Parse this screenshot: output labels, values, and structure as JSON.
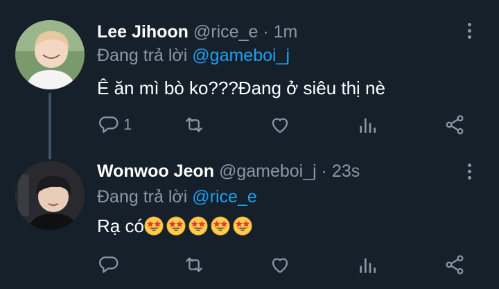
{
  "tweets": [
    {
      "name": "Lee Jihoon",
      "handle": "@rice_e",
      "dot": "·",
      "time": "1m",
      "reply_prefix": "Đang trả lời",
      "reply_to": "@gameboi_j",
      "text": "Ê ăn mì bò ko???Đang ở siêu thị nè",
      "reply_count": "1",
      "avatar_icon": "profile-photo-smiling-boy",
      "icons": [
        "more-vertical-icon",
        "reply-icon",
        "retweet-icon",
        "like-icon",
        "analytics-icon",
        "share-icon"
      ]
    },
    {
      "name": "Wonwoo Jeon",
      "handle": "@gameboi_j",
      "dot": "·",
      "time": "23s",
      "reply_prefix": "Đang trả lời",
      "reply_to": "@rice_e",
      "text": "Rạ có",
      "emoji": "star-struck-emoji ×5",
      "avatar_icon": "profile-photo-boy-dark-hair",
      "icons": [
        "more-vertical-icon",
        "reply-icon",
        "retweet-icon",
        "like-icon",
        "analytics-icon",
        "share-icon"
      ]
    }
  ],
  "colors": {
    "background": "#15202b",
    "text": "#ffffff",
    "muted": "#8899a6",
    "accent": "#1da1f2",
    "thread_line": "#3d5466"
  }
}
